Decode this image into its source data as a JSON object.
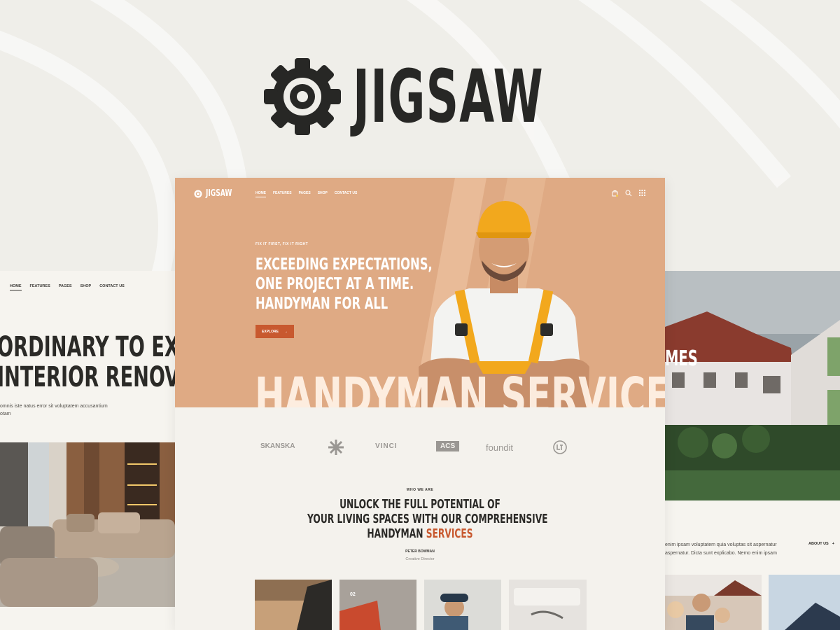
{
  "brand": {
    "name": "JIGSAW",
    "icon": "saw-blade-icon"
  },
  "left_preview": {
    "nav": [
      "HOME",
      "FEATURES",
      "PAGES",
      "SHOP",
      "CONTACT US"
    ],
    "headline": [
      "ORDINARY TO EXTRAC",
      "INTERIOR RENOVATIO"
    ],
    "body": [
      "omnis iste natus error sit voluptatem accusantium",
      "otam"
    ]
  },
  "main": {
    "logo": "JIGSAW",
    "nav": [
      "HOME",
      "FEATURES",
      "PAGES",
      "SHOP",
      "CONTACT US"
    ],
    "icons": [
      "cart-icon",
      "search-icon",
      "grid-menu-icon"
    ],
    "eyebrow": "FIX IT FIRST, FIX IT RIGHT",
    "hero_title": [
      "EXCEEDING EXPECTATIONS,",
      "ONE PROJECT AT A TIME.",
      "HANDYMAN FOR ALL"
    ],
    "explore_label": "EXPLORE",
    "hero_big_text": "HANDYMAN SERVICES",
    "partners": [
      "SKANSKA",
      "VINCI",
      "ACS",
      "foundit"
    ],
    "who_label": "WHO WE ARE",
    "intro_line1": "UNLOCK THE FULL POTENTIAL OF",
    "intro_line2": "YOUR LIVING SPACES WITH OUR COMPREHENSIVE",
    "intro_line3_a": "HANDYMAN",
    "intro_line3_b": "SERVICES",
    "author_name": "PETER BOWMAN",
    "author_role": "Creative Director",
    "tile_number": "02"
  },
  "right_preview": {
    "overlay_text": "MES",
    "body": [
      "enim ipsam voluptatem quia voluptas sit aspernatur",
      "aspernatur. Dicta sunt explicabo. Nemo enim ipsam"
    ],
    "link_label": "ABOUT US"
  },
  "colors": {
    "hero": "#dfaa84",
    "accent": "#c8592f",
    "dark": "#272725",
    "background": "#efeee9"
  }
}
